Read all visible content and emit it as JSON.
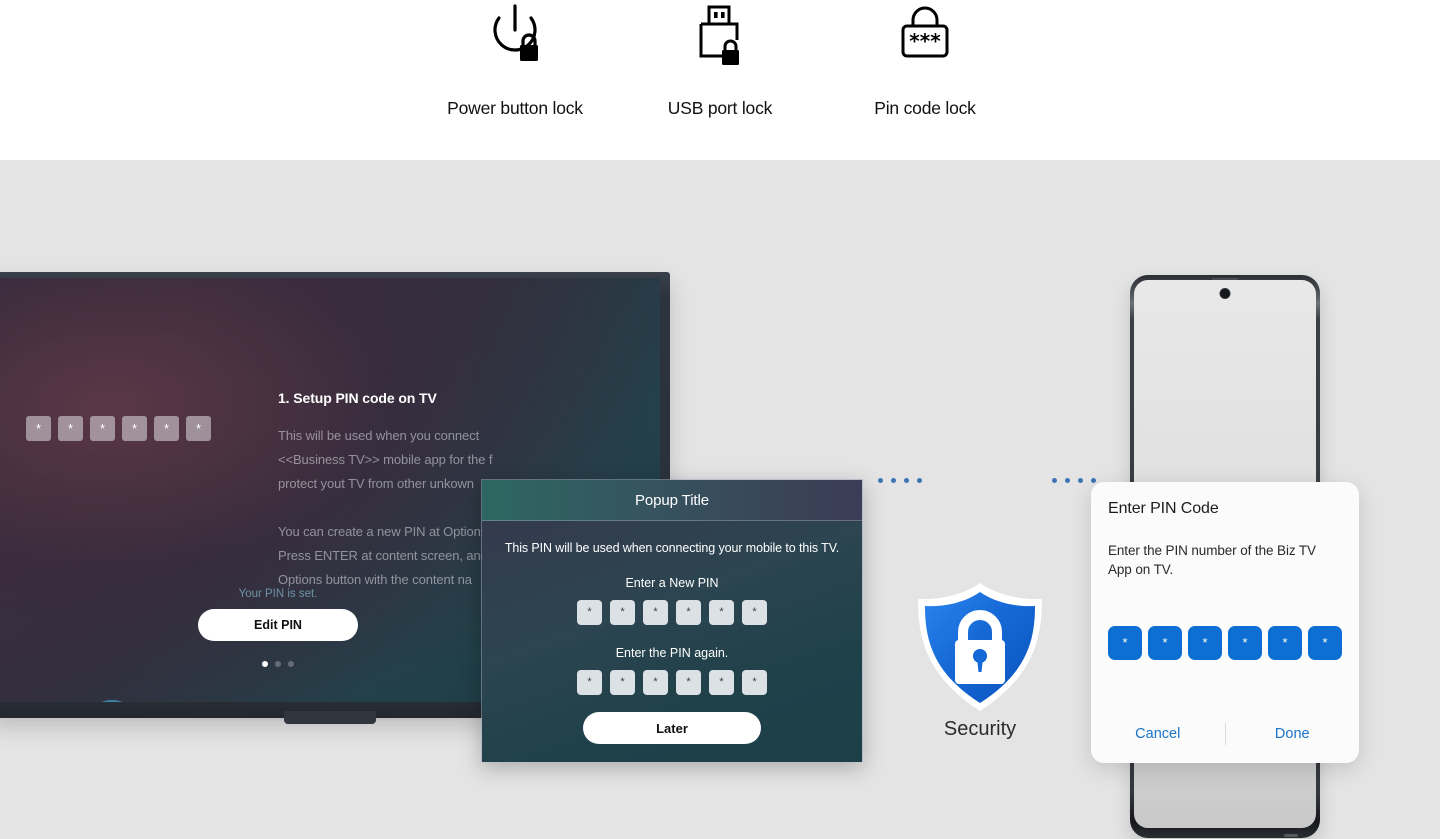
{
  "features": [
    {
      "icon": "power-button-lock-icon",
      "label": "Power button lock"
    },
    {
      "icon": "usb-port-lock-icon",
      "label": "USB port lock"
    },
    {
      "icon": "pin-code-lock-icon",
      "label": "Pin code lock"
    }
  ],
  "tv": {
    "pin_cells": [
      "*",
      "*",
      "*",
      "*",
      "*",
      "*"
    ],
    "heading": "1. Setup PIN code on TV",
    "paragraph": "This will be used when you connect\n<<Business TV>> mobile app for the f\nprotect yout TV from other unkown\n\nYou can create a new PIN at Options\nPress ENTER at content screen, and\nOptions button with the content na",
    "status": "Your PIN is set.",
    "edit_button": "Edit PIN",
    "pagination": {
      "count": 3,
      "active": 0
    }
  },
  "popup": {
    "title": "Popup Title",
    "lead": "This PIN will be used when connecting your mobile to this TV.",
    "new_pin_label": "Enter a New PIN",
    "new_pin_cells": [
      "*",
      "*",
      "*",
      "*",
      "*",
      "*"
    ],
    "confirm_pin_label": "Enter the PIN again.",
    "confirm_pin_cells": [
      "*",
      "*",
      "*",
      "*",
      "*",
      "*"
    ],
    "later_button": "Later"
  },
  "security": {
    "icon": "shield-lock-icon",
    "label": "Security",
    "left_dots": 4,
    "right_dots": 4,
    "dot_color": "#3e74b6",
    "shield_color": "#1569d6"
  },
  "phone_dialog": {
    "title": "Enter PIN Code",
    "message": "Enter the PIN number of the Biz TV App on TV.",
    "pin_cells": [
      "*",
      "*",
      "*",
      "*",
      "*",
      "*"
    ],
    "pin_cell_color": "#0d6fd4",
    "cancel_button": "Cancel",
    "done_button": "Done",
    "action_color": "#1a73c8"
  }
}
